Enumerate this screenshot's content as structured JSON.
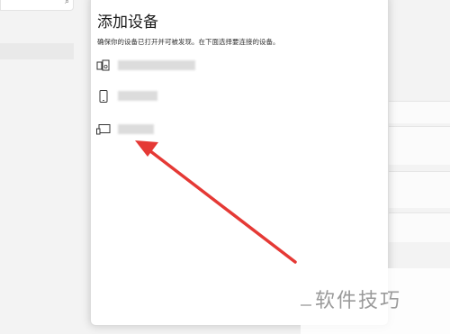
{
  "dialog": {
    "title": "添加设备",
    "description": "确保你的设备已打开并可被发现。在下面选择要连接的设备。",
    "devices": [
      {
        "icon": "audio-device-icon",
        "name": ""
      },
      {
        "icon": "phone-icon",
        "name": ""
      },
      {
        "icon": "display-icon",
        "name": ""
      }
    ]
  },
  "background": {
    "search_icon": "search-icon"
  },
  "annotation": {
    "color": "#e53935"
  },
  "watermark": {
    "text": "软件技巧"
  }
}
